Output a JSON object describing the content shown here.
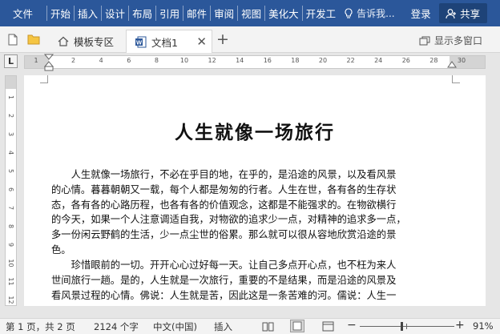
{
  "ribbon": {
    "tabs": [
      "文件",
      "开始",
      "插入",
      "设计",
      "布局",
      "引用",
      "邮件",
      "审阅",
      "视图",
      "美化大",
      "开发工"
    ],
    "tell_me": "告诉我...",
    "login": "登录",
    "share": "共享"
  },
  "doc_tabs": {
    "template_tab": "模板专区",
    "doc_tab": "文档1",
    "show_multi_window": "显示多窗口"
  },
  "ruler": {
    "h_labels": [
      "1",
      "2",
      "4",
      "6",
      "8",
      "10",
      "12",
      "14",
      "16",
      "18",
      "20",
      "22",
      "24",
      "26",
      "28",
      "30"
    ],
    "v_labels": [
      "1",
      "2",
      "3",
      "4",
      "5",
      "6",
      "7",
      "8",
      "9",
      "10",
      "11",
      "12"
    ]
  },
  "document": {
    "title": "人生就像一场旅行",
    "paragraph1_lines": [
      "人生就像一场旅行，不必在乎目的地，在乎的，是沿途的风景，以及看风景",
      "的心情。暮暮朝朝又一载，每个人都是匆匆的行者。人生在世，各有各的生存状",
      "态，各有各的心路历程，也各有各的价值观念，这都是不能强求的。在物欲横行",
      "的今天，如果一个人注意调适自我，对物欲的追求少一点，对精神的追求多一点，",
      "多一份闲云野鹤的生活，少一点尘世的俗累。那么就可以很从容地欣赏沿途的景",
      "色。"
    ],
    "paragraph2_lines": [
      "珍惜眼前的一切。开开心心过好每一天。让自己多点开心点，也不枉为来人",
      "世间旅行一趟。是的，人生就是一次旅行，重要的不是结果，而是沿途的风景及",
      "看风景过程的心情。佛说：人生就是苦，因此这是一条苦难的河。儒说：人生一"
    ]
  },
  "status": {
    "page": "第 1 页，共 2 页",
    "words": "2124 个字",
    "language": "中文(中国)",
    "mode": "插入",
    "zoom": "91%",
    "zoom_value": 91
  },
  "colors": {
    "ribbon": "#2b579a",
    "share_button": "#1e4378",
    "word_icon": "#2b579a"
  }
}
